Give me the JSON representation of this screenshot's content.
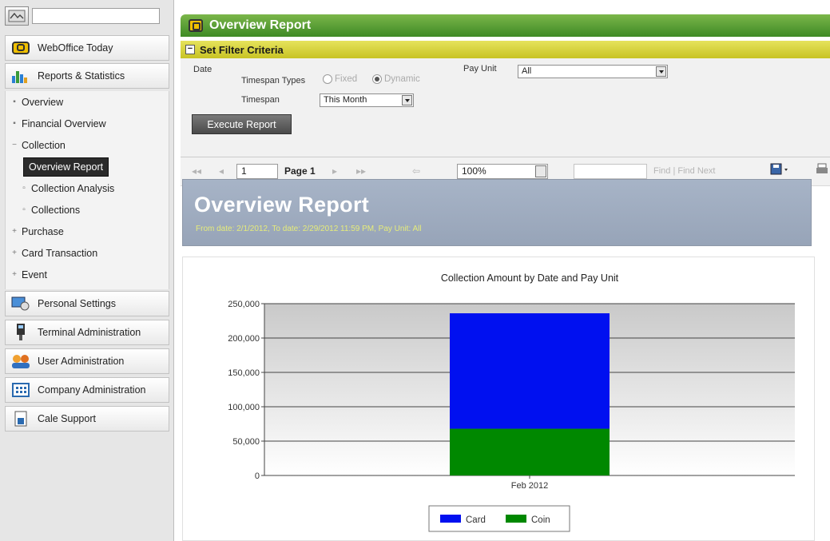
{
  "sidebar": {
    "search_placeholder": "",
    "nav": {
      "webofffice_today": "WebOffice Today",
      "reports_statistics": "Reports & Statistics",
      "personal_settings": "Personal Settings",
      "terminal_admin": "Terminal Administration",
      "user_admin": "User Administration",
      "company_admin": "Company Administration",
      "cale_support": "Cale Support"
    },
    "reports_items": {
      "overview": "Overview",
      "financial_overview": "Financial Overview",
      "collection": "Collection",
      "overview_report": "Overview Report",
      "collection_analysis": "Collection Analysis",
      "collections": "Collections",
      "purchase": "Purchase",
      "card_transaction": "Card Transaction",
      "event": "Event"
    }
  },
  "main": {
    "title": "Overview Report",
    "filter_title": "Set Filter Criteria",
    "filter": {
      "date_label": "Date",
      "timespan_types_label": "Timespan Types",
      "fixed_label": "Fixed",
      "dynamic_label": "Dynamic",
      "timespan_label": "Timespan",
      "timespan_value": "This Month",
      "payunit_label": "Pay Unit",
      "payunit_value": "All",
      "execute_label": "Execute Report"
    },
    "toolbar": {
      "page_value": "1",
      "page_label": "Page 1",
      "zoom_value": "100%",
      "find_label": "Find | Find Next"
    },
    "report": {
      "title": "Overview Report",
      "subtitle": "From date: 2/1/2012, To date: 2/29/2012 11:59 PM, Pay Unit: All"
    }
  },
  "chart_data": {
    "type": "bar",
    "stacked": true,
    "title": "Collection Amount by Date and Pay Unit",
    "categories": [
      "Feb 2012"
    ],
    "series": [
      {
        "name": "Coin",
        "values": [
          68000
        ],
        "color": "#008800"
      },
      {
        "name": "Card",
        "values": [
          168000
        ],
        "color": "#0010f0"
      }
    ],
    "ylim": [
      0,
      250000
    ],
    "yticks": [
      "0",
      "50,000",
      "100,000",
      "150,000",
      "200,000",
      "250,000"
    ],
    "ytick_values": [
      0,
      50000,
      100000,
      150000,
      200000,
      250000
    ],
    "grid": true,
    "legend": "bottom",
    "legend_order": [
      "Card",
      "Coin"
    ]
  }
}
